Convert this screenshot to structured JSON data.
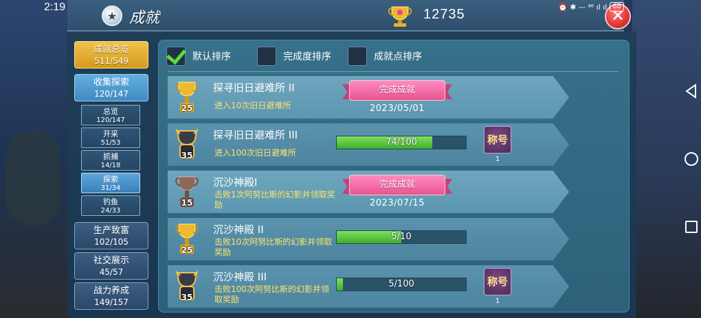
{
  "status_bar": {
    "time": "2:19",
    "icons_text": "⏰ ✱ 𝌀 ⁴⁶ ıl ıl",
    "battery": "68"
  },
  "header": {
    "title": "成就",
    "points": "12735",
    "close_symbol": "✕"
  },
  "nav": {
    "overview": {
      "label": "成就总览",
      "count": "511/549"
    },
    "collect": {
      "label": "收集探索",
      "count": "120/147"
    },
    "sub_items": [
      {
        "label": "总览",
        "count": "120/147"
      },
      {
        "label": "开采",
        "count": "51/53"
      },
      {
        "label": "抓捕",
        "count": "14/18"
      },
      {
        "label": "探索",
        "count": "31/34"
      },
      {
        "label": "钓鱼",
        "count": "24/33"
      }
    ],
    "production": {
      "label": "生产致富",
      "count": "102/105"
    },
    "social": {
      "label": "社交展示",
      "count": "45/57"
    },
    "combat": {
      "label": "战力养成",
      "count": "149/157"
    }
  },
  "sort": {
    "default": "默认排序",
    "completion": "完成度排序",
    "points": "成就点排序"
  },
  "achievements": [
    {
      "title": "探寻旧日避难所 II",
      "level": "25",
      "desc": "进入10次旧日避难所",
      "status": "完成成就",
      "date": "2023/05/01",
      "tier": "gold"
    },
    {
      "title": "探寻旧日避难所 III",
      "level": "35",
      "desc": "进入100次旧日避难所",
      "progress": "74/100",
      "progress_fraction": 0.74,
      "reward": "称号",
      "reward_count": "1",
      "tier": "dark"
    },
    {
      "title": "沉沙神殿I",
      "level": "15",
      "desc": "击败1次阿努比斯的幻影并领取奖励",
      "status": "完成成就",
      "date": "2023/07/15",
      "tier": "bronze"
    },
    {
      "title": "沉沙神殿 II",
      "level": "25",
      "desc": "击败10次阿努比斯的幻影并领取奖励",
      "progress": "5/10",
      "progress_fraction": 0.5,
      "tier": "gold"
    },
    {
      "title": "沉沙神殿 III",
      "level": "35",
      "desc": "击败100次阿努比斯的幻影并领取奖励",
      "progress": "5/100",
      "progress_fraction": 0.05,
      "reward": "称号",
      "reward_count": "1",
      "tier": "dark"
    }
  ],
  "colors": {
    "accent_gold": "#e8b332",
    "progress_green": "#4fc032",
    "ribbon_pink": "#e8558f",
    "desc_yellow": "#ffe46a"
  }
}
